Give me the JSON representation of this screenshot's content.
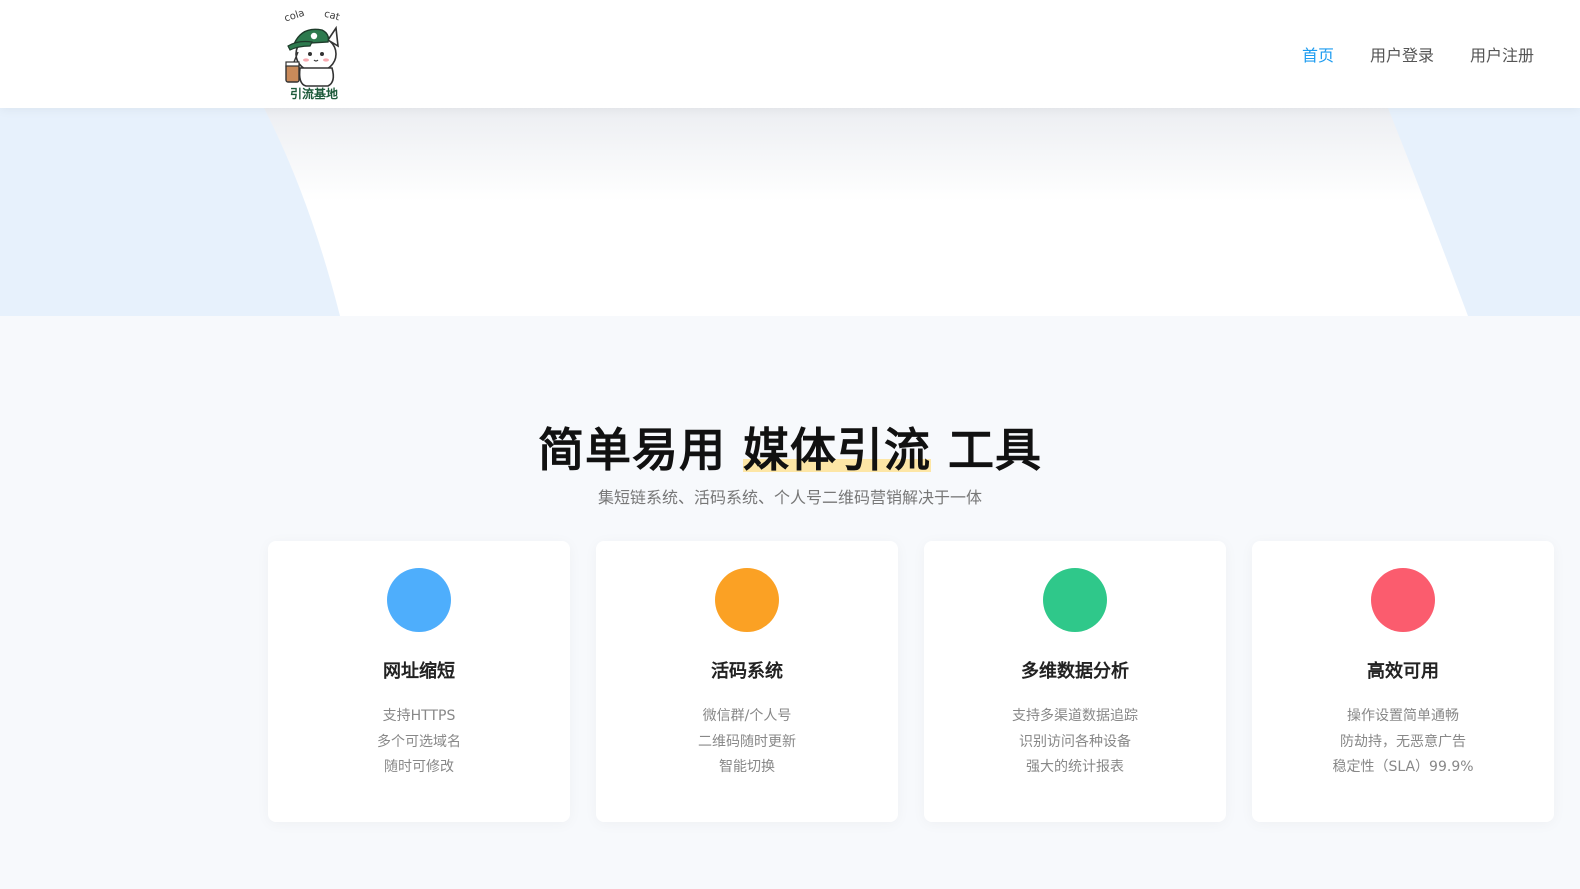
{
  "brand": {
    "logo_text_top_left": "cola",
    "logo_text_top_right": "cat",
    "logo_caption": "引流基地"
  },
  "nav": {
    "items": [
      {
        "label": "首页",
        "active": true
      },
      {
        "label": "用户登录",
        "active": false
      },
      {
        "label": "用户注册",
        "active": false
      }
    ]
  },
  "features": {
    "headline_part1": "简单易用 ",
    "headline_highlight": "媒体引流",
    "headline_part2": " 工具",
    "subtitle": "集短链系统、活码系统、个人号二维码营销解决于一体",
    "cards": [
      {
        "title": "网址缩短",
        "color": "#4eaefc",
        "lines": [
          "支持HTTPS",
          "多个可选域名",
          "随时可修改"
        ]
      },
      {
        "title": "活码系统",
        "color": "#fba124",
        "lines": [
          "微信群/个人号",
          "二维码随时更新",
          "智能切换"
        ]
      },
      {
        "title": "多维数据分析",
        "color": "#2fc88a",
        "lines": [
          "支持多渠道数据追踪",
          "识别访问各种设备",
          "强大的统计报表"
        ]
      },
      {
        "title": "高效可用",
        "color": "#fb5c6e",
        "lines": [
          "操作设置简单通畅",
          "防劫持，无恶意广告",
          "稳定性（SLA）99.9%"
        ]
      }
    ]
  },
  "colors": {
    "accent": "#1e9cf0",
    "hero_bg": "#e7f1fc",
    "highlight": "#fde6a6"
  }
}
